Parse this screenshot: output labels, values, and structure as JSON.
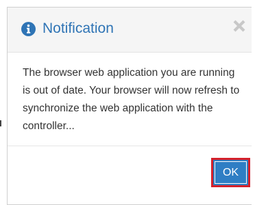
{
  "dialog": {
    "title": "Notification",
    "message": "The browser web application you are running is out of date. Your browser will now refresh to synchronize the web application with the controller...",
    "ok_label": "OK"
  },
  "icons": {
    "title_icon": "info-circle-icon",
    "close_icon": "close-icon"
  },
  "colors": {
    "title": "#2f74b5",
    "header_bg": "#f5f5f5",
    "ok_bg": "#2f7ec4",
    "ok_highlight": "#d4202a",
    "close_icon": "#c8c8c8"
  }
}
